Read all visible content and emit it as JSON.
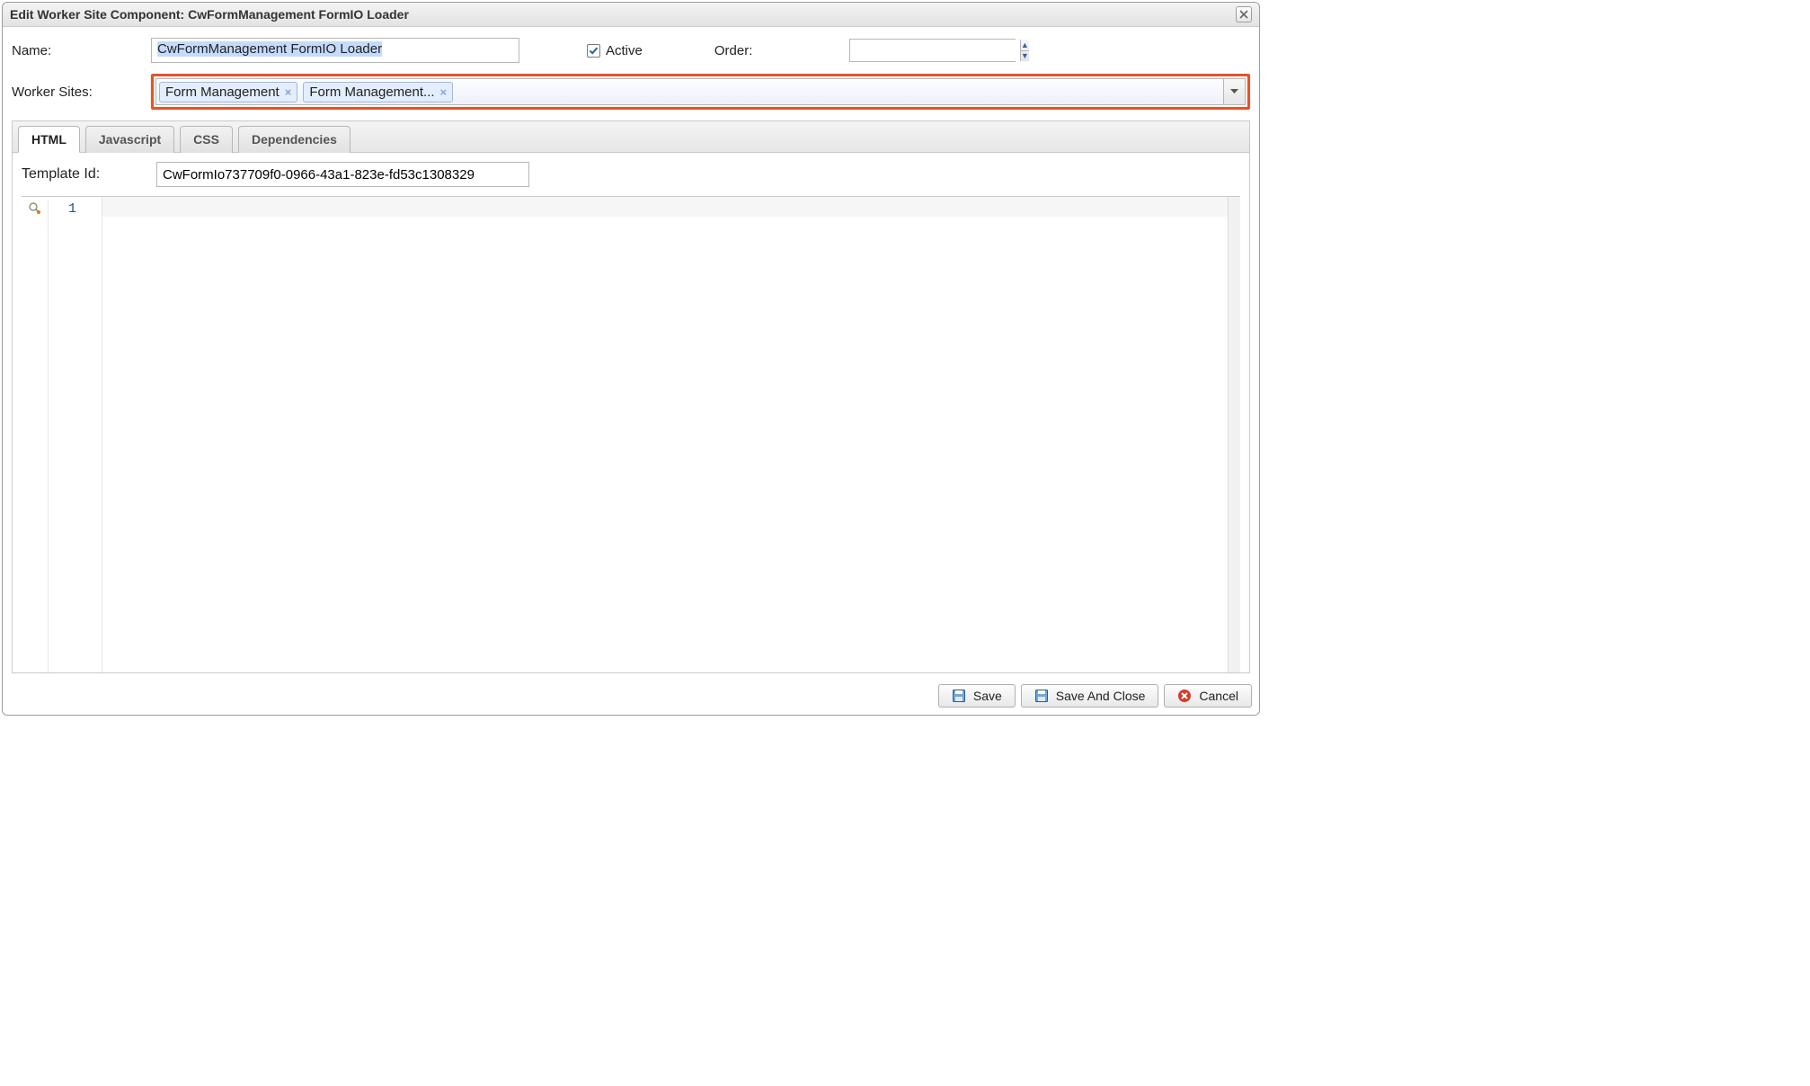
{
  "window": {
    "title": "Edit Worker Site Component: CwFormManagement FormIO Loader"
  },
  "form": {
    "name_label": "Name:",
    "name_value": "CwFormManagement FormIO Loader",
    "active_label": "Active",
    "active_checked": true,
    "order_label": "Order:",
    "order_value": "",
    "worker_sites_label": "Worker Sites:",
    "worker_sites_tags": [
      {
        "label": "Form Management"
      },
      {
        "label": "Form Management..."
      }
    ]
  },
  "tabs": {
    "items": [
      {
        "label": "HTML",
        "active": true
      },
      {
        "label": "Javascript",
        "active": false
      },
      {
        "label": "CSS",
        "active": false
      },
      {
        "label": "Dependencies",
        "active": false
      }
    ],
    "template_id_label": "Template Id:",
    "template_id_value": "CwFormIo737709f0-0966-43a1-823e-fd53c1308329",
    "editor": {
      "line_numbers": [
        "1"
      ],
      "content": ""
    }
  },
  "buttons": {
    "save": "Save",
    "save_close": "Save And Close",
    "cancel": "Cancel"
  }
}
